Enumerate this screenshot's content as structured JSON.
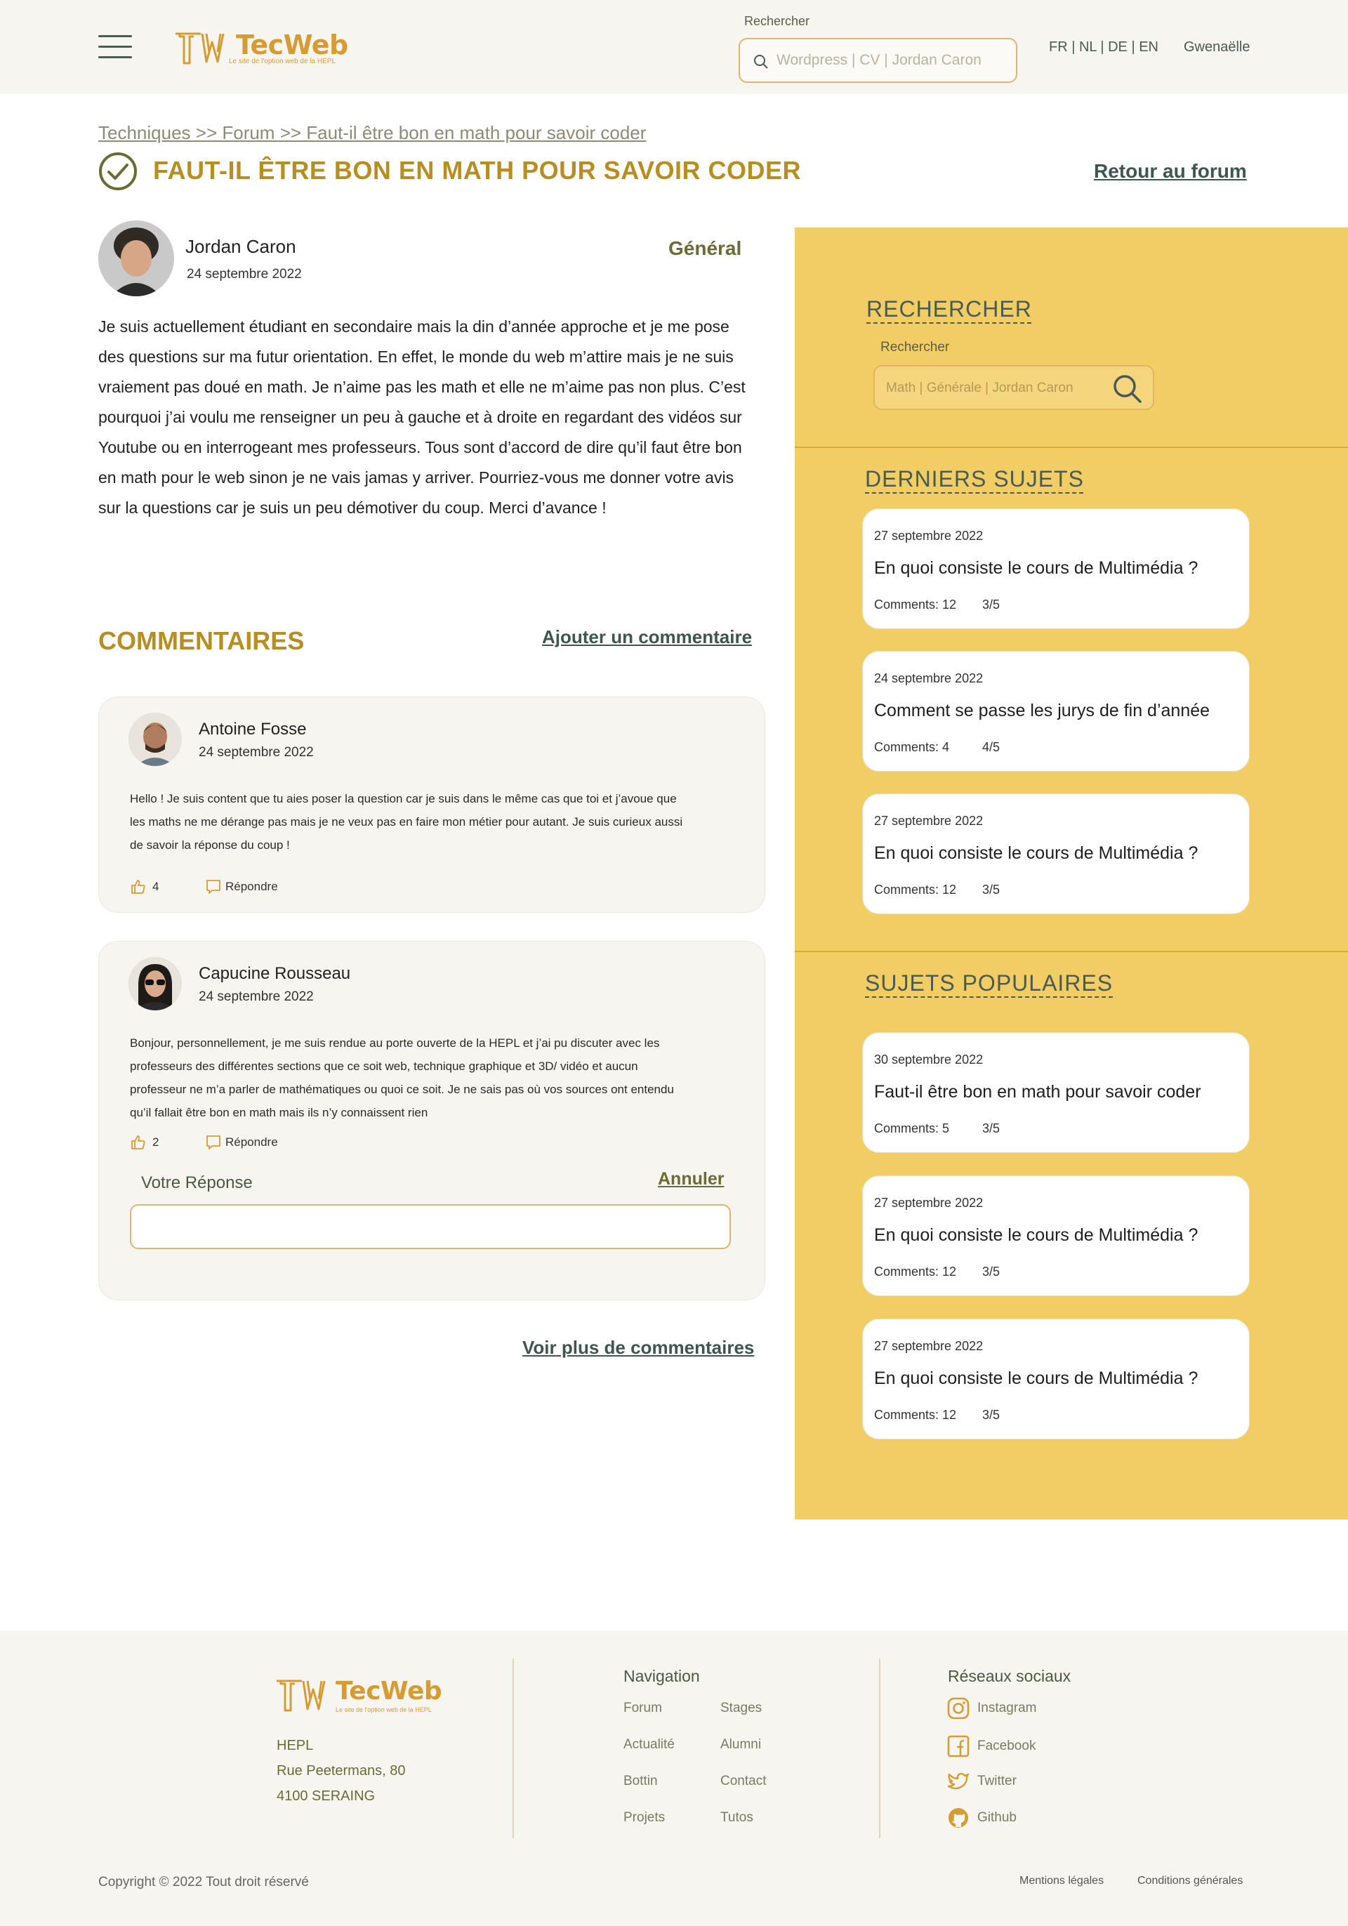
{
  "colors": {
    "accent": "#b88e22",
    "brand_orange": "#d79b34",
    "sidebar": "#f2cd64",
    "dark_link": "#3d5650",
    "header_bg": "#f7f5f0"
  },
  "header": {
    "logo_title": "TecWeb",
    "logo_subtitle": "Le site de l'option web de la HEPL",
    "search_label": "Rechercher",
    "search_placeholder": "Wordpress  |  CV  |  Jordan Caron",
    "languages": "FR | NL | DE | EN",
    "user": "Gwenaëlle"
  },
  "breadcrumb": "Techniques >> Forum >> Faut-il être bon en math pour savoir coder",
  "page_title": "FAUT-IL ÊTRE BON EN MATH POUR SAVOIR CODER",
  "back_link": "Retour au forum",
  "post": {
    "author": "Jordan Caron",
    "date": "24 septembre 2022",
    "category": "Général",
    "body": "Je suis actuellement étudiant en secondaire mais la din d’année approche et je me pose des questions sur ma futur orientation. En effet, le monde du web m’attire mais je ne suis vraiement pas doué en math. Je n’aime pas les math et elle ne m’aime pas non plus. C’est pourquoi j’ai voulu me renseigner un peu à gauche et à droite en regardant des vidéos sur Youtube ou en interrogeant mes professeurs. Tous sont d’accord de dire qu’il faut être bon en math pour le web sinon je ne vais jamas y arriver. Pourriez-vous me donner votre avis sur la questions car je suis un peu démotiver du coup. Merci d’avance !"
  },
  "comments": {
    "title": "COMMENTAIRES",
    "add_label": "Ajouter un commentaire",
    "items": [
      {
        "author": "Antoine Fosse",
        "date": "24 septembre 2022",
        "text": "Hello ! Je suis content que tu aies poser la question car je suis dans le même cas que toi et j’avoue que les maths ne me dérange pas mais je ne veux pas en faire mon métier pour autant. Je suis curieux aussi de savoir la réponse du coup !",
        "likes": "4",
        "reply_label": "Répondre"
      },
      {
        "author": "Capucine Rousseau",
        "date": "24 septembre 2022",
        "text": "Bonjour, personnellement, je me suis rendue au porte ouverte de la HEPL et j’ai pu discuter avec les professeurs des différentes sections que ce soit web, technique graphique et 3D/ vidéo et aucun professeur ne m’a parler de mathématiques ou quoi ce soit. Je ne sais pas où vos sources ont entendu qu’il fallait être bon en math mais ils n’y connaissent rien",
        "likes": "2",
        "reply_label": "Répondre"
      }
    ],
    "reply_form": {
      "label": "Votre Réponse",
      "cancel": "Annuler",
      "value": ""
    },
    "more_label": "Voir plus de commentaires"
  },
  "sidebar": {
    "search_heading": "RECHERCHER",
    "search_label": "Rechercher",
    "search_placeholder": "Math  |  Générale |  Jordan Caron",
    "latest_heading": "DERNIERS SUJETS",
    "latest": [
      {
        "date": "27 septembre 2022",
        "title": "En quoi consiste le cours de Multimédia ?",
        "comments": "Comments: 12",
        "rating": "3/5"
      },
      {
        "date": "24 septembre 2022",
        "title": "Comment se passe les jurys de fin d’année",
        "comments": "Comments: 4",
        "rating": "4/5"
      },
      {
        "date": "27 septembre 2022",
        "title": "En quoi consiste le cours de Multimédia ?",
        "comments": "Comments: 12",
        "rating": "3/5"
      }
    ],
    "popular_heading": "SUJETS POPULAIRES",
    "popular": [
      {
        "date": "30 septembre 2022",
        "title": "Faut-il être bon en math pour savoir coder",
        "comments": "Comments: 5",
        "rating": "3/5"
      },
      {
        "date": "27 septembre 2022",
        "title": "En quoi consiste le cours de Multimédia ?",
        "comments": "Comments: 12",
        "rating": "3/5"
      },
      {
        "date": "27 septembre 2022",
        "title": "En quoi consiste le cours de Multimédia ?",
        "comments": "Comments: 12",
        "rating": "3/5"
      }
    ]
  },
  "footer": {
    "logo_title": "TecWeb",
    "logo_subtitle": "Le site de l'option web de la HEPL",
    "address": [
      "HEPL",
      "Rue Peetermans, 80",
      "4100 SERAING"
    ],
    "nav_title": "Navigation",
    "nav_links": [
      "Forum",
      "Stages",
      "Actualité",
      "Alumni",
      "Bottin",
      "Contact",
      "Projets",
      "Tutos"
    ],
    "social_title": "Réseaux sociaux",
    "social": [
      {
        "label": "Instagram",
        "icon": "instagram-icon"
      },
      {
        "label": "Facebook",
        "icon": "facebook-icon"
      },
      {
        "label": "Twitter",
        "icon": "twitter-icon"
      },
      {
        "label": "Github",
        "icon": "github-icon"
      }
    ],
    "copyright": "Copyright © 2022 Tout droit réservé",
    "legal": [
      "Mentions légales",
      "Conditions générales"
    ]
  }
}
